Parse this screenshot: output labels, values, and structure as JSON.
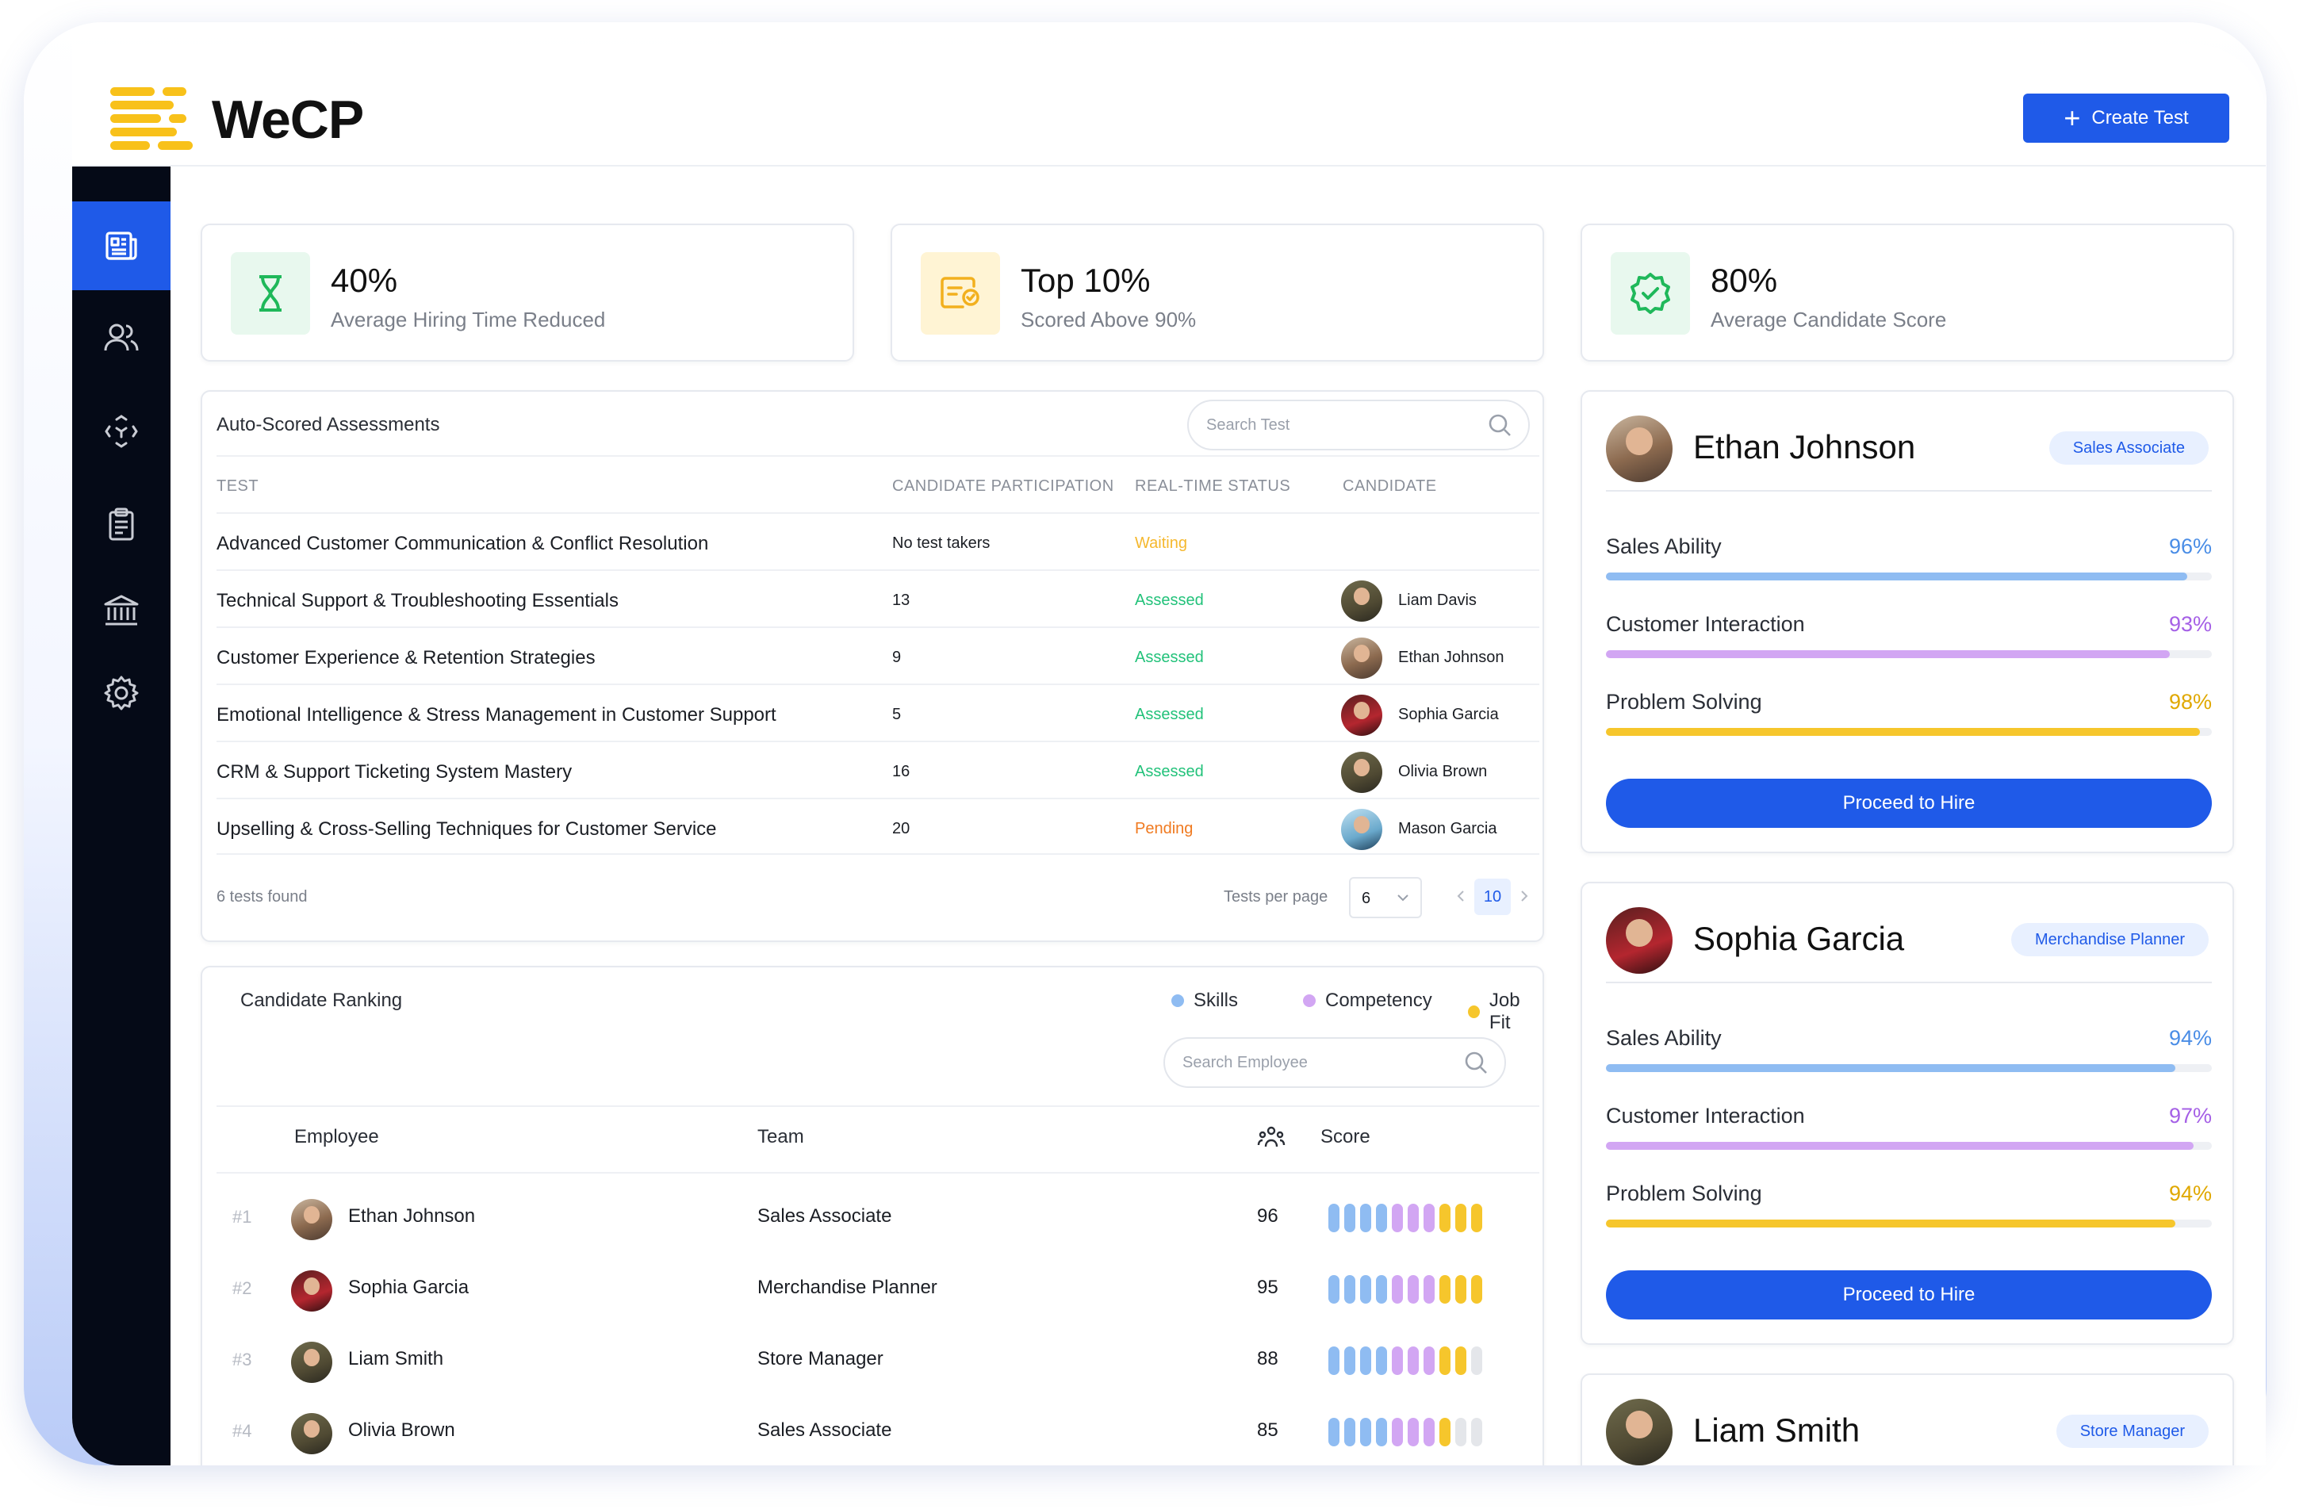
{
  "app": {
    "logo_text": "WeCP",
    "create_label": "Create Test"
  },
  "sidebar": {
    "items": [
      {
        "icon": "news-icon",
        "active": true
      },
      {
        "icon": "users-icon",
        "active": false
      },
      {
        "icon": "scan-icon",
        "active": false
      },
      {
        "icon": "clipboard-icon",
        "active": false
      },
      {
        "icon": "bank-icon",
        "active": false
      },
      {
        "icon": "gear-icon",
        "active": false
      }
    ]
  },
  "stats": [
    {
      "value": "40%",
      "label": "Average Hiring Time Reduced",
      "icon": "hourglass-icon",
      "bg": "#e8f8ee",
      "color": "#1fb85a"
    },
    {
      "value": "Top 10%",
      "label": "Scored Above 90%",
      "icon": "certificate-icon",
      "bg": "#fff4d4",
      "color": "#f2b01e"
    },
    {
      "value": "80%",
      "label": "Average Candidate Score",
      "icon": "verified-icon",
      "bg": "#e8f8ee",
      "color": "#1fb85a"
    }
  ],
  "assessments": {
    "title": "Auto-Scored Assessments",
    "search_placeholder": "Search Test",
    "columns": [
      "TEST",
      "CANDIDATE PARTICIPATION",
      "REAL-TIME STATUS",
      "CANDIDATE"
    ],
    "rows": [
      {
        "test": "Advanced Customer Communication & Conflict Resolution",
        "participation": "No test takers",
        "status": "Waiting",
        "status_color": "#f5b82e",
        "candidate": ""
      },
      {
        "test": "Technical Support & Troubleshooting Essentials",
        "participation": "13",
        "status": "Assessed",
        "status_color": "#22c27a",
        "candidate": "Liam Davis"
      },
      {
        "test": "Customer Experience & Retention Strategies",
        "participation": "9",
        "status": "Assessed",
        "status_color": "#22c27a",
        "candidate": "Ethan Johnson"
      },
      {
        "test": "Emotional Intelligence & Stress Management in Customer Support",
        "participation": "5",
        "status": "Assessed",
        "status_color": "#22c27a",
        "candidate": "Sophia Garcia"
      },
      {
        "test": "CRM & Support Ticketing System Mastery",
        "participation": "16",
        "status": "Assessed",
        "status_color": "#22c27a",
        "candidate": "Olivia Brown"
      },
      {
        "test": "Upselling & Cross-Selling Techniques for Customer Service",
        "participation": "20",
        "status": "Pending",
        "status_color": "#f07a20",
        "candidate": "Mason Garcia"
      }
    ],
    "found_text": "6 tests found",
    "per_page_label": "Tests per page",
    "per_page_value": "6",
    "current_page": "10"
  },
  "ranking": {
    "title": "Candidate Ranking",
    "legend": [
      {
        "label": "Skills",
        "color": "#8fbcf2"
      },
      {
        "label": "Competency",
        "color": "#d2a6f3"
      },
      {
        "label": "Job Fit",
        "color": "#f6c62c"
      }
    ],
    "search_placeholder": "Search Employee",
    "columns": {
      "employee": "Employee",
      "team": "Team",
      "score": "Score"
    },
    "rows": [
      {
        "rank": "#1",
        "name": "Ethan Johnson",
        "team": "Sales Associate",
        "score": "96",
        "filled": 10
      },
      {
        "rank": "#2",
        "name": "Sophia Garcia",
        "team": "Merchandise Planner",
        "score": "95",
        "filled": 10
      },
      {
        "rank": "#3",
        "name": "Liam Smith",
        "team": "Store Manager",
        "score": "88",
        "filled": 9
      },
      {
        "rank": "#4",
        "name": "Olivia Brown",
        "team": "Sales Associate",
        "score": "85",
        "filled": 8
      }
    ]
  },
  "profiles": [
    {
      "name": "Ethan Johnson",
      "role": "Sales Associate",
      "skills": [
        {
          "label": "Sales Ability",
          "value": "96%",
          "pct": 96,
          "color": "#4a8de6",
          "bar": "#8fbcf2"
        },
        {
          "label": "Customer Interaction",
          "value": "93%",
          "pct": 93,
          "color": "#a560e6",
          "bar": "#d2a6f3"
        },
        {
          "label": "Problem Solving",
          "value": "98%",
          "pct": 98,
          "color": "#e0a800",
          "bar": "#f6c62c"
        }
      ],
      "button": "Proceed to Hire"
    },
    {
      "name": "Sophia Garcia",
      "role": "Merchandise Planner",
      "skills": [
        {
          "label": "Sales Ability",
          "value": "94%",
          "pct": 94,
          "color": "#4a8de6",
          "bar": "#8fbcf2"
        },
        {
          "label": "Customer Interaction",
          "value": "97%",
          "pct": 97,
          "color": "#a560e6",
          "bar": "#d2a6f3"
        },
        {
          "label": "Problem Solving",
          "value": "94%",
          "pct": 94,
          "color": "#e0a800",
          "bar": "#f6c62c"
        }
      ],
      "button": "Proceed to Hire"
    },
    {
      "name": "Liam Smith",
      "role": "Store Manager"
    }
  ]
}
